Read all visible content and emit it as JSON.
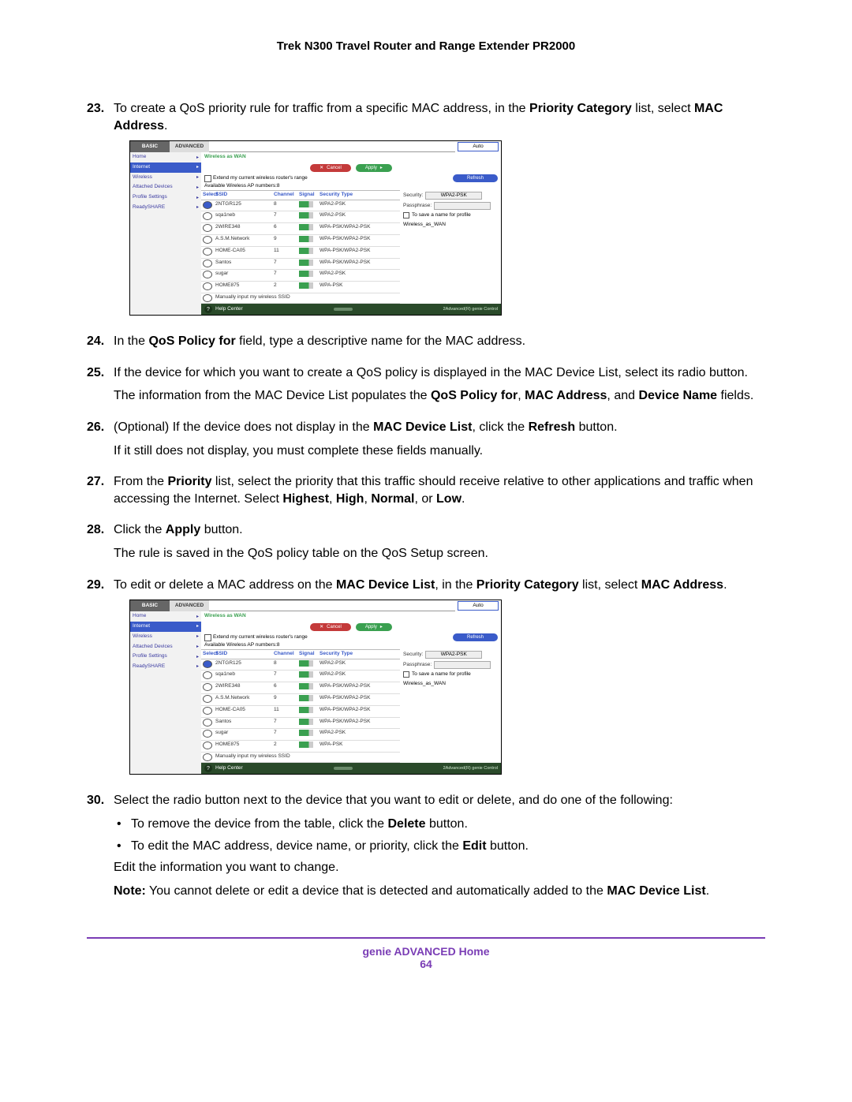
{
  "doc_title": "Trek N300 Travel Router and Range Extender PR2000",
  "footer": {
    "section": "genie ADVANCED Home",
    "page": "64"
  },
  "steps": {
    "s23_num": "23.",
    "s23": "To create a QoS priority rule for traffic from a specific MAC address, in the ",
    "s23_b1": "Priority Category",
    "s23_mid": " list, select ",
    "s23_b2": "MAC Address",
    "s23_end": ".",
    "s24_num": "24.",
    "s24a": "In the ",
    "s24b": "QoS Policy for",
    "s24c": " field, type a descriptive name for the MAC address.",
    "s25_num": "25.",
    "s25": "If the device for which you want to create a QoS policy is displayed in the MAC Device List, select its radio button.",
    "s25_p2a": "The information from the MAC Device List populates the ",
    "s25_p2b1": "QoS Policy for",
    "s25_p2m1": ", ",
    "s25_p2b2": "MAC Address",
    "s25_p2m2": ", and ",
    "s25_p2b3": "Device Name",
    "s25_p2e": " fields.",
    "s26_num": "26.",
    "s26a": "(Optional) If the device does not display in the ",
    "s26b": "MAC Device List",
    "s26c": ", click the ",
    "s26d": "Refresh",
    "s26e": " button.",
    "s26_p2": "If it still does not display, you must complete these fields manually.",
    "s27_num": "27.",
    "s27a": "From the ",
    "s27b": "Priority",
    "s27c": " list, select the priority that this traffic should receive relative to other applications and traffic when accessing the Internet. Select ",
    "s27d": "Highest",
    "s27e": ", ",
    "s27f": "High",
    "s27g": ", ",
    "s27h": "Normal",
    "s27i": ", or ",
    "s27j": "Low",
    "s27k": ".",
    "s28_num": "28.",
    "s28a": "Click the ",
    "s28b": "Apply",
    "s28c": " button.",
    "s28_p2": "The rule is saved in the QoS policy table on the QoS Setup screen.",
    "s29_num": "29.",
    "s29a": "To edit or delete a MAC address on the ",
    "s29b": "MAC Device List",
    "s29c": ", in the ",
    "s29d": "Priority Category",
    "s29e": " list, select ",
    "s29f": "MAC Address",
    "s29g": ".",
    "s30_num": "30.",
    "s30": "Select the radio button next to the device that you want to edit or delete, and do one of the following:",
    "b1a": "To remove the device from the table, click the ",
    "b1b": "Delete",
    "b1c": " button.",
    "b2a": "To edit the MAC address, device name, or priority, click the ",
    "b2b": "Edit",
    "b2c": " button.",
    "sub": "Edit the information you want to change.",
    "note_lbl": "Note:",
    "note_a": "  You cannot delete or edit a device that is detected and automatically added to the ",
    "note_b": "MAC Device List",
    "note_c": "."
  },
  "shot": {
    "tabs": {
      "basic": "BASIC",
      "advanced": "ADVANCED",
      "dropdown": "Auto"
    },
    "sidebar": [
      "Home",
      "Internet",
      "Wireless",
      "Attached Devices",
      "Profile Settings",
      "ReadySHARE"
    ],
    "breadcrumb": "Wireless as WAN",
    "buttons": {
      "cancel": "Cancel",
      "apply": "Apply",
      "refresh": "Refresh"
    },
    "extend": "Extend my current wireless router's range",
    "avail": "Available Wireless AP numbers:8",
    "th": {
      "select": "Select",
      "ssid": "SSID",
      "ch": "Channel",
      "sig": "Signal",
      "sec": "Security Type"
    },
    "rows": [
      {
        "ssid": "2NTGR125",
        "ch": "8",
        "sec": "WPA2-PSK",
        "sel": true
      },
      {
        "ssid": "sqa1neb",
        "ch": "7",
        "sec": "WPA2-PSK"
      },
      {
        "ssid": "2WIRE348",
        "ch": "6",
        "sec": "WPA-PSK/WPA2-PSK"
      },
      {
        "ssid": "A.S.M.Network",
        "ch": "9",
        "sec": "WPA-PSK/WPA2-PSK"
      },
      {
        "ssid": "HOME-CA05",
        "ch": "11",
        "sec": "WPA-PSK/WPA2-PSK"
      },
      {
        "ssid": "Santos",
        "ch": "7",
        "sec": "WPA-PSK/WPA2-PSK"
      },
      {
        "ssid": "sugar",
        "ch": "7",
        "sec": "WPA2-PSK"
      },
      {
        "ssid": "HOME875",
        "ch": "2",
        "sec": "WPA-PSK"
      },
      {
        "ssid": "Manually input my wireless SSID",
        "ch": "",
        "sec": ""
      }
    ],
    "right": {
      "security": "Security:",
      "security_val": "WPA2-PSK",
      "pass": "Passphrase:",
      "save": "To save a name for profile",
      "profile": "Wireless_as_WAN"
    },
    "help": "Help Center",
    "genie": "2Advanced(R) genie Control"
  }
}
